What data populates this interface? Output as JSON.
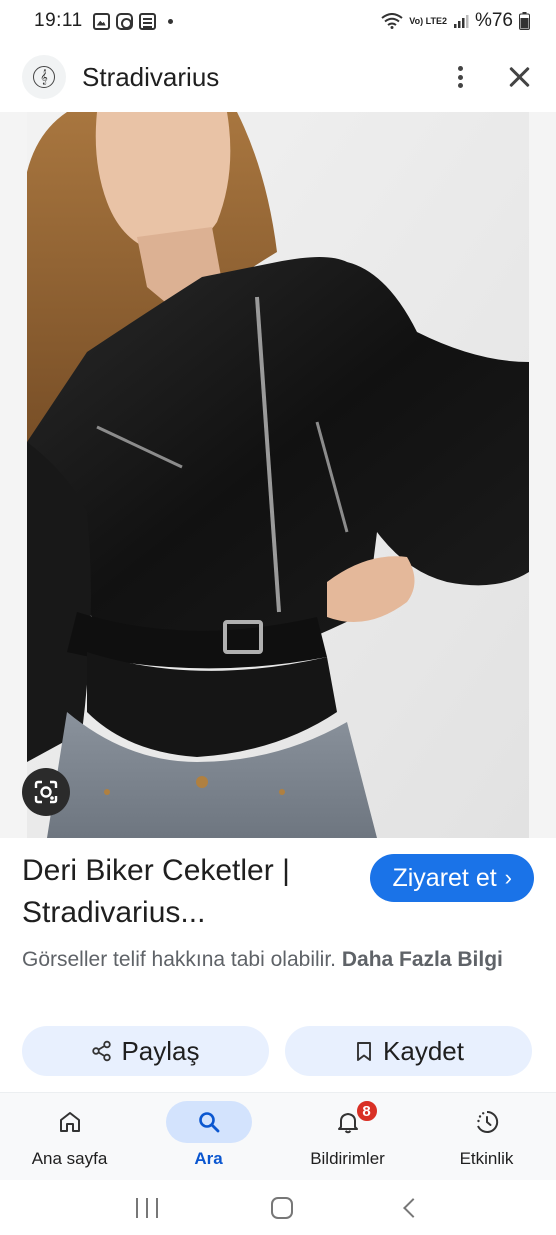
{
  "status_bar": {
    "time": "19:11",
    "battery_text": "%76",
    "network_label": "Vo) LTE2"
  },
  "header": {
    "title": "Stradivarius",
    "logo_icon": "stradivarius-logo"
  },
  "result": {
    "title": "Deri Biker Ceketler | Stradivarius...",
    "visit_label": "Ziyaret et",
    "copyright_text": "Görseller telif hakkına tabi olabilir.",
    "more_info_label": "Daha Fazla Bilgi"
  },
  "actions": {
    "share_label": "Paylaş",
    "save_label": "Kaydet"
  },
  "bottom_nav": {
    "items": [
      {
        "label": "Ana sayfa",
        "icon": "home-icon"
      },
      {
        "label": "Ara",
        "icon": "search-icon"
      },
      {
        "label": "Bildirimler",
        "icon": "bell-icon",
        "badge": "8"
      },
      {
        "label": "Etkinlik",
        "icon": "activity-icon"
      }
    ],
    "active_index": 1
  },
  "colors": {
    "accent": "#1a73e8",
    "pill_bg": "#e8f0fe",
    "active_nav_bg": "#d3e3fd",
    "badge": "#d93025"
  }
}
